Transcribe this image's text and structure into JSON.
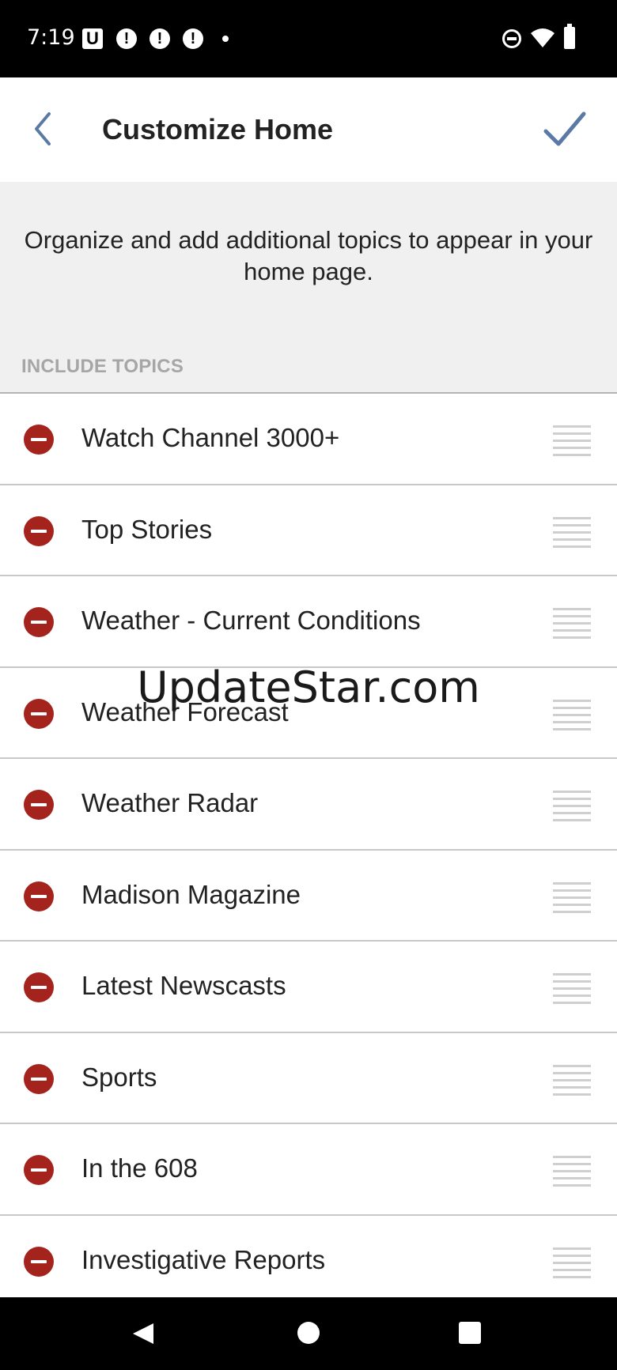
{
  "status_bar": {
    "time": "7:19",
    "notification_icons": [
      "u-app-icon",
      "alert-icon",
      "alert-icon",
      "alert-icon",
      "dot-icon"
    ],
    "system_icons": [
      "do-not-disturb-icon",
      "wifi-icon",
      "battery-icon"
    ]
  },
  "app_bar": {
    "title": "Customize Home",
    "back_icon": "chevron-left-icon",
    "done_icon": "checkmark-icon",
    "accent_color": "#5a79a4"
  },
  "intro": {
    "text": "Organize and add additional topics to appear in your home page."
  },
  "section": {
    "header": "INCLUDE TOPICS"
  },
  "topics": [
    {
      "label": "Watch Channel 3000+"
    },
    {
      "label": "Top Stories"
    },
    {
      "label": "Weather - Current Conditions"
    },
    {
      "label": "Weather Forecast"
    },
    {
      "label": "Weather Radar"
    },
    {
      "label": "Madison Magazine"
    },
    {
      "label": "Latest Newscasts"
    },
    {
      "label": "Sports"
    },
    {
      "label": "In the 608"
    },
    {
      "label": "Investigative Reports"
    }
  ],
  "topic_icons": {
    "remove": "remove-circle-icon",
    "drag": "drag-handle-icon",
    "remove_color": "#a5231d"
  },
  "watermark": "UpdateStar.com",
  "nav_bar": {
    "buttons": [
      "nav-back-icon",
      "nav-home-icon",
      "nav-recents-icon"
    ]
  }
}
